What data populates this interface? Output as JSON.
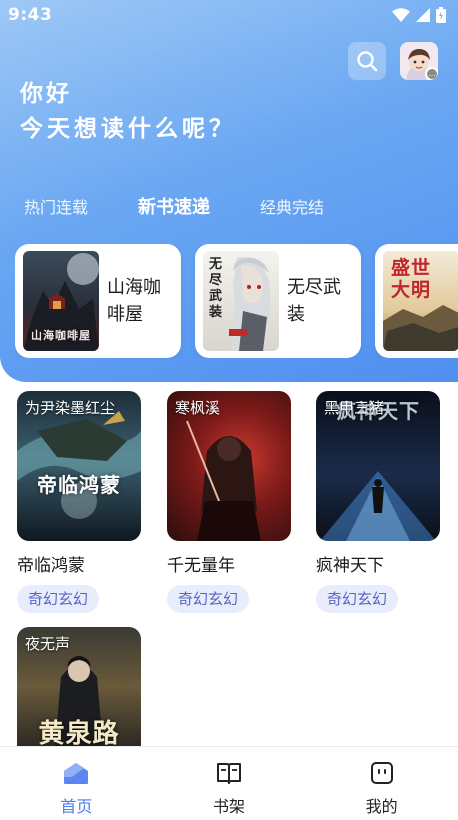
{
  "status_bar": {
    "time": "9:43"
  },
  "header": {
    "greeting_line1": "你好",
    "greeting_line2": "今天想读什么呢？",
    "icons": [
      "search-icon",
      "avatar"
    ]
  },
  "tabs": [
    {
      "label": "热门连载",
      "active": false
    },
    {
      "label": "新书速递",
      "active": true
    },
    {
      "label": "经典完结",
      "active": false
    }
  ],
  "carousel": [
    {
      "name": "山海咖啡屋",
      "cover_text": "山海咖啡屋"
    },
    {
      "name": "无尽武装",
      "cover_text": "无尽武装"
    },
    {
      "name": "",
      "cover_text": "盛世大明"
    }
  ],
  "books": [
    {
      "author": "为尹染墨红尘",
      "title": "帝临鸿蒙",
      "tag": "奇幻玄幻",
      "cover_text": "帝临鸿蒙"
    },
    {
      "author": "寒枫溪",
      "title": "千无量年",
      "tag": "奇幻玄幻",
      "cover_text": ""
    },
    {
      "author": "黑甲三猪",
      "title": "疯神天下",
      "tag": "奇幻玄幻",
      "cover_text": "疯神天下"
    },
    {
      "author": "夜无声",
      "title": "",
      "tag": "",
      "cover_text": "黄泉路"
    }
  ],
  "bottom_nav": [
    {
      "label": "首页",
      "icon": "home-icon",
      "active": true
    },
    {
      "label": "书架",
      "icon": "bookshelf-icon",
      "active": false
    },
    {
      "label": "我的",
      "icon": "profile-icon",
      "active": false
    }
  ],
  "colors": {
    "accent": "#4d7cf0",
    "hero_start": "#9ec8f6",
    "hero_end": "#4f8ff0",
    "tag_bg": "#e9edfb",
    "tag_text": "#5863c8"
  }
}
